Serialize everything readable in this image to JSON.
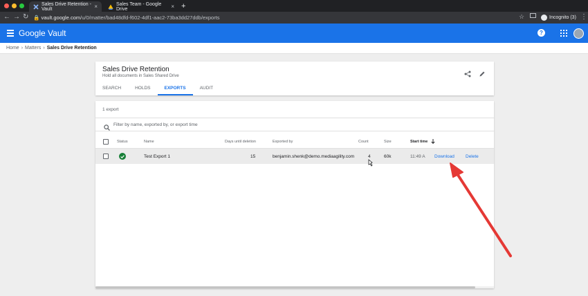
{
  "browser": {
    "tabs": [
      {
        "title": "Sales Drive Retention - Vault",
        "active": true
      },
      {
        "title": "Sales Team - Google Drive",
        "active": false
      }
    ],
    "url_host": "vault.google.com",
    "url_path": "/u/0/matter/bad48dfd-f602-4df1-aac2-73ba3dd27ddb/exports",
    "profile": "Incognito (3)"
  },
  "app": {
    "name": "Google Vault",
    "color": "#1a73e8"
  },
  "breadcrumb": [
    "Home",
    "Matters",
    "Sales Drive Retention"
  ],
  "matter": {
    "title": "Sales Drive Retention",
    "description": "Hold all documents in Sales Shared Drive",
    "tabs": [
      "SEARCH",
      "HOLDS",
      "EXPORTS",
      "AUDIT"
    ],
    "selected_tab": "EXPORTS"
  },
  "exports": {
    "count_label": "1 export",
    "filter_placeholder": "Filter by name, exported by, or export time",
    "columns": {
      "status": "Status",
      "name": "Name",
      "days": "Days until deletion",
      "exported_by": "Exported by",
      "count": "Count",
      "size": "Size",
      "start_time": "Start time"
    },
    "rows": [
      {
        "status": "success",
        "name": "Test Export 1",
        "days": "15",
        "exported_by": "benjamin.shenk@demo.mediaagility.com",
        "count": "4",
        "size": "60k",
        "start_time": "11:49 A",
        "download": "Download",
        "delete": "Delete"
      }
    ]
  },
  "annotation": {
    "color": "#e53935"
  }
}
